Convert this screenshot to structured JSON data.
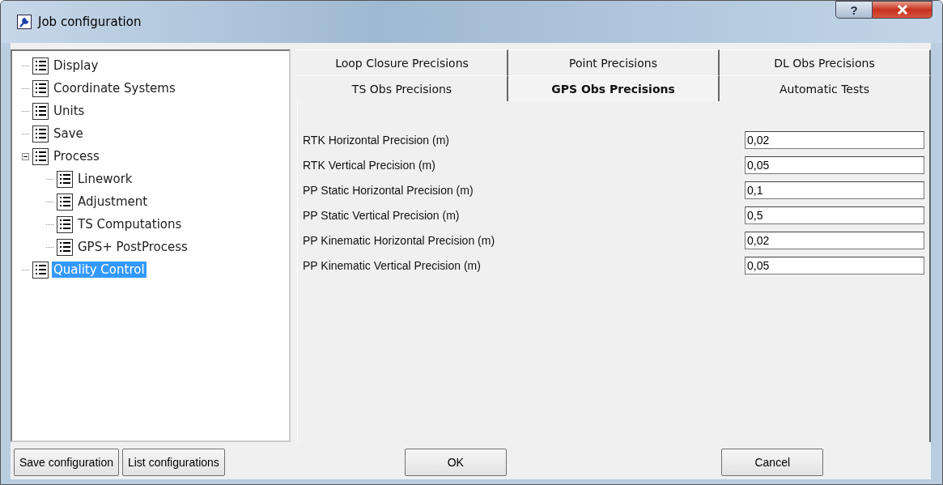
{
  "window": {
    "title": "Job configuration",
    "help_button": "?"
  },
  "tree": [
    {
      "label": "Display",
      "selected": false
    },
    {
      "label": "Coordinate Systems",
      "selected": false
    },
    {
      "label": "Units",
      "selected": false
    },
    {
      "label": "Save",
      "selected": false
    },
    {
      "label": "Process",
      "selected": false,
      "expanded": true,
      "children": [
        {
          "label": "Linework",
          "selected": false
        },
        {
          "label": "Adjustment",
          "selected": false
        },
        {
          "label": "TS Computations",
          "selected": false
        },
        {
          "label": "GPS+ PostProcess",
          "selected": false
        }
      ]
    },
    {
      "label": "Quality Control",
      "selected": true
    }
  ],
  "tab_rows": [
    [
      {
        "label": "Loop Closure Precisions",
        "selected": false
      },
      {
        "label": "Point Precisions",
        "selected": false
      },
      {
        "label": "DL Obs Precisions",
        "selected": false
      }
    ],
    [
      {
        "label": "TS Obs Precisions",
        "selected": false
      },
      {
        "label": "GPS Obs Precisions",
        "selected": true
      },
      {
        "label": "Automatic Tests",
        "selected": false
      }
    ]
  ],
  "fields": [
    {
      "label": "RTK Horizontal Precision (m)",
      "value": "0,02"
    },
    {
      "label": "RTK Vertical Precision (m)",
      "value": "0,05"
    },
    {
      "label": "PP Static Horizontal Precision (m)",
      "value": "0,1"
    },
    {
      "label": "PP Static Vertical Precision (m)",
      "value": "0,5"
    },
    {
      "label": "PP Kinematic Horizontal Precision (m)",
      "value": "0,02"
    },
    {
      "label": "PP Kinematic Vertical Precision (m)",
      "value": "0,05"
    }
  ],
  "left_buttons": [
    "Save configuration",
    "List configurations"
  ],
  "buttons": [
    "OK",
    "Cancel"
  ]
}
